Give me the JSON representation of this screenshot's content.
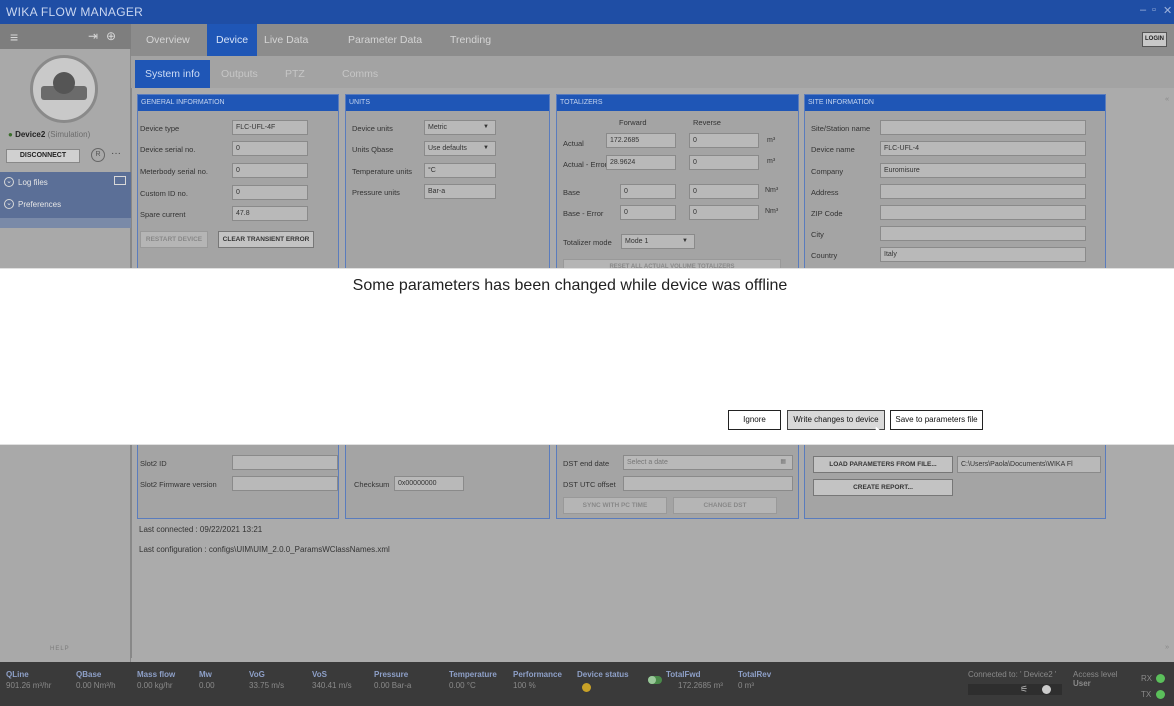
{
  "app": {
    "title": "WIKA FLOW MANAGER"
  },
  "sidebar": {
    "device_name": "Device2",
    "device_mode": "(Simulation)",
    "disconnect_label": "DISCONNECT",
    "round_button_label": "R",
    "more_label": "···",
    "items": [
      {
        "label": "Log files"
      },
      {
        "label": "Preferences"
      }
    ],
    "help_label": "HELP"
  },
  "main_tabs": [
    "Overview",
    "Device",
    "Live Data",
    "Parameter Data",
    "Trending"
  ],
  "active_main_tab": "Device",
  "sub_tabs": [
    "System info",
    "Outputs",
    "PTZ",
    "Comms"
  ],
  "active_sub_tab": "System info",
  "login_label": "LOGIN",
  "general": {
    "title": "GENERAL INFORMATION",
    "device_type_label": "Device type",
    "device_type": "FLC-UFL-4F",
    "serial_label": "Device serial no.",
    "serial": "0",
    "meterbody_label": "Meterbody serial no.",
    "meterbody": "0",
    "custom_id_label": "Custom ID no.",
    "custom_id": "0",
    "spare_current_label": "Spare current",
    "spare_current": "47.8",
    "restart_label": "RESTART DEVICE",
    "clear_error_label": "CLEAR TRANSIENT ERROR",
    "slot2_id_label": "Slot2 ID",
    "slot2_id": "",
    "slot2_fw_label": "Slot2 Firmware version",
    "slot2_fw": ""
  },
  "units": {
    "title": "UNITS",
    "device_units_label": "Device units",
    "device_units": "Metric",
    "qbase_label": "Units Qbase",
    "qbase": "Use defaults",
    "temperature_label": "Temperature units",
    "temperature": "°C",
    "pressure_label": "Pressure units",
    "pressure": "Bar-a",
    "checksum_label": "Checksum",
    "checksum": "0x00000000"
  },
  "totalizers": {
    "title": "TOTALIZERS",
    "forward_label": "Forward",
    "reverse_label": "Reverse",
    "rows": [
      {
        "label": "Actual",
        "forward": "172.2685",
        "reverse": "0",
        "unit": "m³"
      },
      {
        "label": "Actual - Error",
        "forward": "28.9624",
        "reverse": "0",
        "unit": "m³"
      },
      {
        "label": "Base",
        "forward": "0",
        "reverse": "0",
        "unit": "Nm³"
      },
      {
        "label": "Base - Error",
        "forward": "0",
        "reverse": "0",
        "unit": "Nm³"
      }
    ],
    "mode_label": "Totalizer mode",
    "mode": "Mode 1",
    "reset_label": "RESET ALL ACTUAL VOLUME TOTALIZERS",
    "dst_end_label": "DST end date",
    "dst_end_placeholder": "Select a date",
    "dst_offset_label": "DST UTC offset",
    "dst_offset": "",
    "sync_label": "SYNC WITH PC TIME",
    "change_dst_label": "CHANGE DST"
  },
  "site": {
    "title": "SITE INFORMATION",
    "station_label": "Site/Station name",
    "station": "",
    "device_name_label": "Device name",
    "device_name": "FLC-UFL-4",
    "company_label": "Company",
    "company": "Euromisure",
    "address_label": "Address",
    "address": "",
    "zip_label": "ZIP Code",
    "zip": "",
    "city_label": "City",
    "city": "",
    "country_label": "Country",
    "country": "Italy",
    "load_params_label": "LOAD PARAMETERS FROM FILE...",
    "load_path": "C:\\Users\\Paola\\Documents\\WIKA Fl",
    "report_label": "CREATE REPORT..."
  },
  "last_connected": "Last connected :  09/22/2021 13:21",
  "last_configuration": "Last configuration :  configs\\UIM\\UIM_2.0.0_ParamsWClassNames.xml",
  "dialog": {
    "message": "Some parameters has been changed while device was offline",
    "ignore_label": "Ignore",
    "write_label": "Write changes to device",
    "save_label": "Save to parameters file"
  },
  "status": {
    "items": [
      {
        "key": "QLine",
        "value": "901.26 m³/hr"
      },
      {
        "key": "QBase",
        "value": "0.00 Nm³/h"
      },
      {
        "key": "Mass flow",
        "value": "0.00 kg/hr"
      },
      {
        "key": "Mw",
        "value": "0.00"
      },
      {
        "key": "VoG",
        "value": "33.75 m/s"
      },
      {
        "key": "VoS",
        "value": "340.41 m/s"
      },
      {
        "key": "Pressure",
        "value": "0.00 Bar-a"
      },
      {
        "key": "Temperature",
        "value": "0.00 °C"
      },
      {
        "key": "Performance",
        "value": "100 %"
      },
      {
        "key": "Device status",
        "value": ""
      },
      {
        "key": "TotalFwd",
        "value": "172.2685 m³"
      },
      {
        "key": "TotalRev",
        "value": "0 m³"
      }
    ],
    "connected_to": "Connected to: ' Device2 '",
    "access_level_label": "Access level",
    "access_level": "User",
    "rx_label": "RX",
    "tx_label": "TX",
    "colors": {
      "led_green": "#5bc05b",
      "status_yellow": "#c9a227",
      "accent_blue": "#1f56b6"
    }
  }
}
